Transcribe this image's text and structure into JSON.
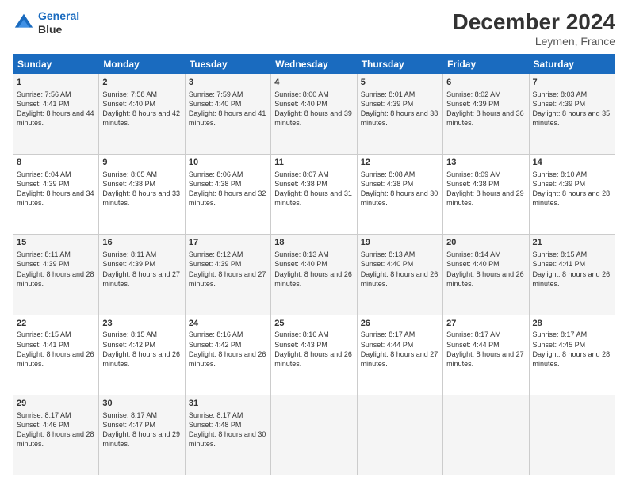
{
  "header": {
    "logo_line1": "General",
    "logo_line2": "Blue",
    "title": "December 2024",
    "subtitle": "Leymen, France"
  },
  "calendar": {
    "headers": [
      "Sunday",
      "Monday",
      "Tuesday",
      "Wednesday",
      "Thursday",
      "Friday",
      "Saturday"
    ],
    "weeks": [
      [
        null,
        null,
        null,
        {
          "day": "4",
          "sunrise": "Sunrise: 8:00 AM",
          "sunset": "Sunset: 4:40 PM",
          "daylight": "Daylight: 8 hours and 39 minutes."
        },
        {
          "day": "5",
          "sunrise": "Sunrise: 8:01 AM",
          "sunset": "Sunset: 4:39 PM",
          "daylight": "Daylight: 8 hours and 38 minutes."
        },
        {
          "day": "6",
          "sunrise": "Sunrise: 8:02 AM",
          "sunset": "Sunset: 4:39 PM",
          "daylight": "Daylight: 8 hours and 36 minutes."
        },
        {
          "day": "7",
          "sunrise": "Sunrise: 8:03 AM",
          "sunset": "Sunset: 4:39 PM",
          "daylight": "Daylight: 8 hours and 35 minutes."
        }
      ],
      [
        {
          "day": "1",
          "sunrise": "Sunrise: 7:56 AM",
          "sunset": "Sunset: 4:41 PM",
          "daylight": "Daylight: 8 hours and 44 minutes."
        },
        {
          "day": "2",
          "sunrise": "Sunrise: 7:58 AM",
          "sunset": "Sunset: 4:40 PM",
          "daylight": "Daylight: 8 hours and 42 minutes."
        },
        {
          "day": "3",
          "sunrise": "Sunrise: 7:59 AM",
          "sunset": "Sunset: 4:40 PM",
          "daylight": "Daylight: 8 hours and 41 minutes."
        },
        {
          "day": "4",
          "sunrise": "Sunrise: 8:00 AM",
          "sunset": "Sunset: 4:40 PM",
          "daylight": "Daylight: 8 hours and 39 minutes."
        },
        {
          "day": "5",
          "sunrise": "Sunrise: 8:01 AM",
          "sunset": "Sunset: 4:39 PM",
          "daylight": "Daylight: 8 hours and 38 minutes."
        },
        {
          "day": "6",
          "sunrise": "Sunrise: 8:02 AM",
          "sunset": "Sunset: 4:39 PM",
          "daylight": "Daylight: 8 hours and 36 minutes."
        },
        {
          "day": "7",
          "sunrise": "Sunrise: 8:03 AM",
          "sunset": "Sunset: 4:39 PM",
          "daylight": "Daylight: 8 hours and 35 minutes."
        }
      ],
      [
        {
          "day": "8",
          "sunrise": "Sunrise: 8:04 AM",
          "sunset": "Sunset: 4:39 PM",
          "daylight": "Daylight: 8 hours and 34 minutes."
        },
        {
          "day": "9",
          "sunrise": "Sunrise: 8:05 AM",
          "sunset": "Sunset: 4:38 PM",
          "daylight": "Daylight: 8 hours and 33 minutes."
        },
        {
          "day": "10",
          "sunrise": "Sunrise: 8:06 AM",
          "sunset": "Sunset: 4:38 PM",
          "daylight": "Daylight: 8 hours and 32 minutes."
        },
        {
          "day": "11",
          "sunrise": "Sunrise: 8:07 AM",
          "sunset": "Sunset: 4:38 PM",
          "daylight": "Daylight: 8 hours and 31 minutes."
        },
        {
          "day": "12",
          "sunrise": "Sunrise: 8:08 AM",
          "sunset": "Sunset: 4:38 PM",
          "daylight": "Daylight: 8 hours and 30 minutes."
        },
        {
          "day": "13",
          "sunrise": "Sunrise: 8:09 AM",
          "sunset": "Sunset: 4:38 PM",
          "daylight": "Daylight: 8 hours and 29 minutes."
        },
        {
          "day": "14",
          "sunrise": "Sunrise: 8:10 AM",
          "sunset": "Sunset: 4:39 PM",
          "daylight": "Daylight: 8 hours and 28 minutes."
        }
      ],
      [
        {
          "day": "15",
          "sunrise": "Sunrise: 8:11 AM",
          "sunset": "Sunset: 4:39 PM",
          "daylight": "Daylight: 8 hours and 28 minutes."
        },
        {
          "day": "16",
          "sunrise": "Sunrise: 8:11 AM",
          "sunset": "Sunset: 4:39 PM",
          "daylight": "Daylight: 8 hours and 27 minutes."
        },
        {
          "day": "17",
          "sunrise": "Sunrise: 8:12 AM",
          "sunset": "Sunset: 4:39 PM",
          "daylight": "Daylight: 8 hours and 27 minutes."
        },
        {
          "day": "18",
          "sunrise": "Sunrise: 8:13 AM",
          "sunset": "Sunset: 4:40 PM",
          "daylight": "Daylight: 8 hours and 26 minutes."
        },
        {
          "day": "19",
          "sunrise": "Sunrise: 8:13 AM",
          "sunset": "Sunset: 4:40 PM",
          "daylight": "Daylight: 8 hours and 26 minutes."
        },
        {
          "day": "20",
          "sunrise": "Sunrise: 8:14 AM",
          "sunset": "Sunset: 4:40 PM",
          "daylight": "Daylight: 8 hours and 26 minutes."
        },
        {
          "day": "21",
          "sunrise": "Sunrise: 8:15 AM",
          "sunset": "Sunset: 4:41 PM",
          "daylight": "Daylight: 8 hours and 26 minutes."
        }
      ],
      [
        {
          "day": "22",
          "sunrise": "Sunrise: 8:15 AM",
          "sunset": "Sunset: 4:41 PM",
          "daylight": "Daylight: 8 hours and 26 minutes."
        },
        {
          "day": "23",
          "sunrise": "Sunrise: 8:15 AM",
          "sunset": "Sunset: 4:42 PM",
          "daylight": "Daylight: 8 hours and 26 minutes."
        },
        {
          "day": "24",
          "sunrise": "Sunrise: 8:16 AM",
          "sunset": "Sunset: 4:42 PM",
          "daylight": "Daylight: 8 hours and 26 minutes."
        },
        {
          "day": "25",
          "sunrise": "Sunrise: 8:16 AM",
          "sunset": "Sunset: 4:43 PM",
          "daylight": "Daylight: 8 hours and 26 minutes."
        },
        {
          "day": "26",
          "sunrise": "Sunrise: 8:17 AM",
          "sunset": "Sunset: 4:44 PM",
          "daylight": "Daylight: 8 hours and 27 minutes."
        },
        {
          "day": "27",
          "sunrise": "Sunrise: 8:17 AM",
          "sunset": "Sunset: 4:44 PM",
          "daylight": "Daylight: 8 hours and 27 minutes."
        },
        {
          "day": "28",
          "sunrise": "Sunrise: 8:17 AM",
          "sunset": "Sunset: 4:45 PM",
          "daylight": "Daylight: 8 hours and 28 minutes."
        }
      ],
      [
        {
          "day": "29",
          "sunrise": "Sunrise: 8:17 AM",
          "sunset": "Sunset: 4:46 PM",
          "daylight": "Daylight: 8 hours and 28 minutes."
        },
        {
          "day": "30",
          "sunrise": "Sunrise: 8:17 AM",
          "sunset": "Sunset: 4:47 PM",
          "daylight": "Daylight: 8 hours and 29 minutes."
        },
        {
          "day": "31",
          "sunrise": "Sunrise: 8:17 AM",
          "sunset": "Sunset: 4:48 PM",
          "daylight": "Daylight: 8 hours and 30 minutes."
        },
        null,
        null,
        null,
        null
      ]
    ]
  }
}
